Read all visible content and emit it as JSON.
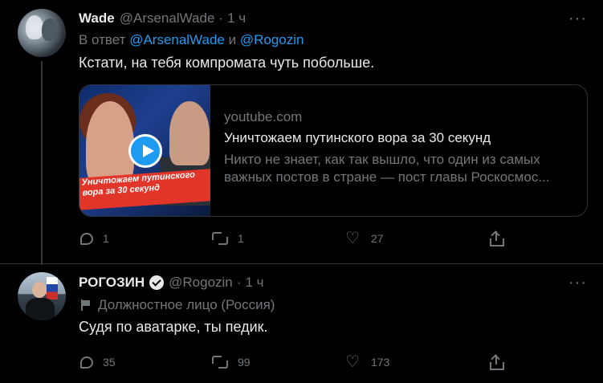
{
  "tweets": [
    {
      "name": "Wade",
      "handle": "@ArsenalWade",
      "dot": "·",
      "time": "1 ч",
      "more": "···",
      "reply_prefix": "В ответ",
      "reply_mention1": "@ArsenalWade",
      "reply_and": "и",
      "reply_mention2": "@Rogozin",
      "text": "Кстати, на тебя компромата чуть побольше.",
      "card": {
        "thumb_text": "Уничтожаем путинского вора за 30 секунд",
        "domain": "youtube.com",
        "title": "Уничтожаем путинского вора за 30 секунд",
        "description": "Никто не знает, как так вышло, что один из самых важных постов в стране — пост главы Роскосмос..."
      },
      "actions": {
        "replies": "1",
        "retweets": "1",
        "likes": "27"
      }
    },
    {
      "name": "РОГОЗИН",
      "handle": "@Rogozin",
      "dot": "·",
      "time": "1 ч",
      "more": "···",
      "label": "Должностное лицо (Россия)",
      "text": "Судя по аватарке, ты педик.",
      "actions": {
        "replies": "35",
        "retweets": "99",
        "likes": "173"
      }
    }
  ],
  "icons": {
    "reply": "reply-icon",
    "retweet": "retweet-icon",
    "like": "heart-icon",
    "share": "share-icon",
    "verified": "verified-badge-icon",
    "government_label": "flag-icon"
  },
  "colors": {
    "background": "#000000",
    "text": "#e7e9ea",
    "secondary": "#71767b",
    "link": "#1d9bf0",
    "border": "#2f3336"
  }
}
